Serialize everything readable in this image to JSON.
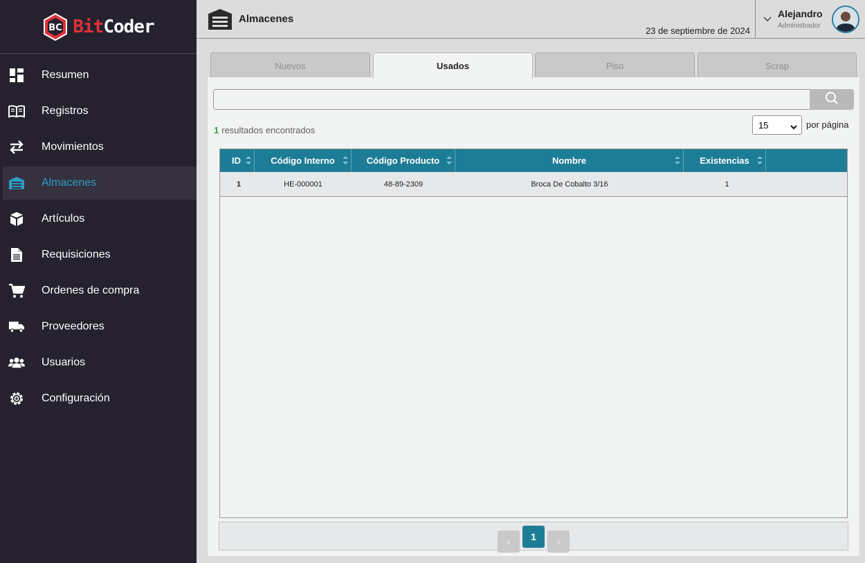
{
  "brand": {
    "part1": "Bit",
    "part2": "Coder",
    "logo_letters": "BC",
    "accent": "#e0313a"
  },
  "sidebar": {
    "items": [
      {
        "label": "Resumen",
        "icon": "dashboard-icon"
      },
      {
        "label": "Registros",
        "icon": "book-icon"
      },
      {
        "label": "Movimientos",
        "icon": "arrows-exchange-icon"
      },
      {
        "label": "Almacenes",
        "icon": "warehouse-icon",
        "active": true
      },
      {
        "label": "Artículos",
        "icon": "box-icon"
      },
      {
        "label": "Requisiciones",
        "icon": "document-icon"
      },
      {
        "label": "Ordenes de compra",
        "icon": "cart-icon"
      },
      {
        "label": "Proveedores",
        "icon": "truck-icon"
      },
      {
        "label": "Usuarios",
        "icon": "users-icon"
      },
      {
        "label": "Configuración",
        "icon": "gear-icon"
      }
    ]
  },
  "header": {
    "title": "Almacenes",
    "date": "23 de septiembre de 2024",
    "user": {
      "name": "Alejandro",
      "role": "Administrador"
    }
  },
  "tabs": [
    {
      "label": "Nuevos"
    },
    {
      "label": "Usados",
      "active": true
    },
    {
      "label": "Piso"
    },
    {
      "label": "Scrap"
    }
  ],
  "search": {
    "placeholder": ""
  },
  "results": {
    "count": "1",
    "text": "resultados encontrados"
  },
  "per_page": {
    "value": "15",
    "label": "por página"
  },
  "table": {
    "columns": [
      "ID",
      "Código Interno",
      "Código Producto",
      "Nombre",
      "Existencias"
    ],
    "rows": [
      [
        "1",
        "HE-000001",
        "48-89-2309",
        "Broca De Cobalto 3/16",
        "1"
      ]
    ]
  },
  "pagination": {
    "prev": "‹",
    "current": "1",
    "next": "›"
  },
  "colors": {
    "sidebar_bg": "#25212f",
    "active_nav": "#2f9bc4",
    "table_header": "#1e7d96",
    "count_green": "#2ea043"
  }
}
